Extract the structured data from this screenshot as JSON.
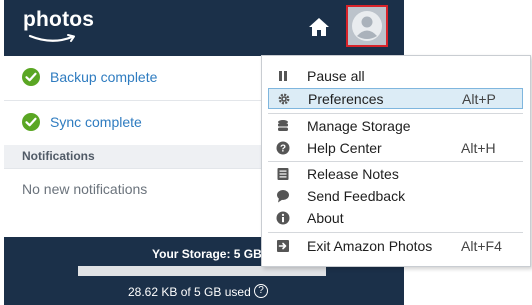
{
  "header": {
    "logo_text": "photos",
    "home_icon": "home-icon",
    "avatar_icon": "user-avatar-icon",
    "brand_color": "#1b3049",
    "highlight_color": "#d8232a"
  },
  "status": [
    {
      "label": "Backup complete",
      "icon": "check-circle-icon"
    },
    {
      "label": "Sync complete",
      "icon": "check-circle-icon"
    }
  ],
  "notifications": {
    "heading": "Notifications",
    "empty_text": "No new notifications"
  },
  "storage": {
    "title": "Your Storage: 5 GB",
    "used_text": "28.62 KB of 5 GB used",
    "help_icon": "help-icon",
    "used_fraction": 0.0
  },
  "menu": {
    "items": [
      {
        "label": "Pause all",
        "shortcut": "",
        "icon": "pause-icon"
      },
      {
        "label": "Preferences",
        "shortcut": "Alt+P",
        "icon": "gear-icon",
        "selected": true
      },
      {
        "label": "Manage Storage",
        "shortcut": "",
        "icon": "database-icon"
      },
      {
        "label": "Help Center",
        "shortcut": "Alt+H",
        "icon": "question-circle-icon"
      },
      {
        "label": "Release Notes",
        "shortcut": "",
        "icon": "notes-icon"
      },
      {
        "label": "Send Feedback",
        "shortcut": "",
        "icon": "speech-bubble-icon"
      },
      {
        "label": "About",
        "shortcut": "",
        "icon": "info-icon"
      },
      {
        "label": "Exit Amazon Photos",
        "shortcut": "Alt+F4",
        "icon": "exit-icon"
      }
    ]
  }
}
